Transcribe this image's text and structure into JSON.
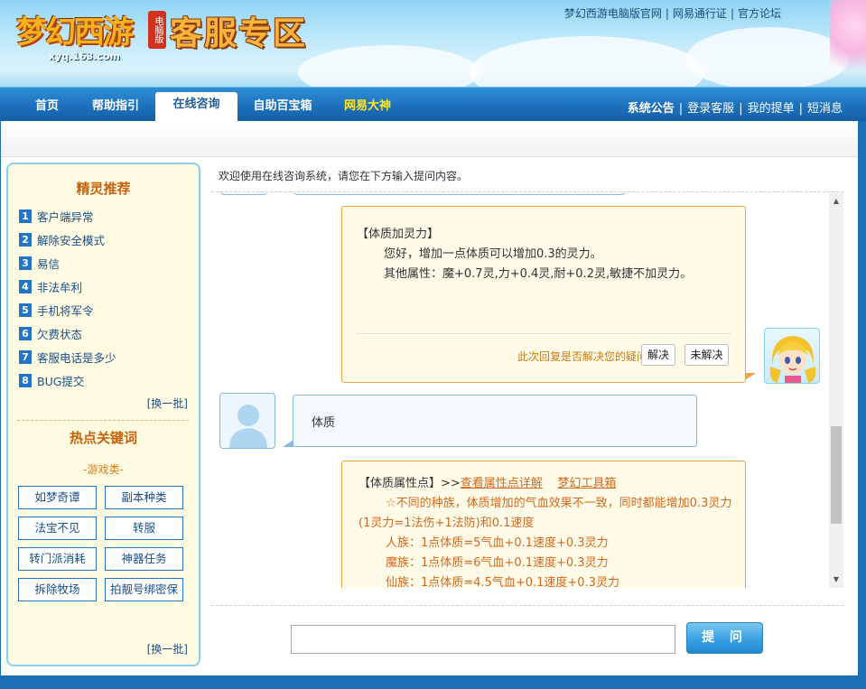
{
  "header": {
    "logo_text": "梦幻西游",
    "logo_badge": "电脑版",
    "logo_url": "xyq.163.com",
    "zone_title": "客服专区",
    "top_links": [
      "梦幻西游电脑版官网",
      "网易通行证",
      "官方论坛"
    ]
  },
  "nav": {
    "tabs": [
      {
        "label": "首页"
      },
      {
        "label": "帮助指引"
      },
      {
        "label": "在线咨询",
        "active": true
      },
      {
        "label": "自助百宝箱"
      },
      {
        "label": "网易大神",
        "highlight": "#ffe629"
      }
    ],
    "right_links": [
      "系统公告",
      "登录客服",
      "我的提单",
      "短消息"
    ]
  },
  "sidebar": {
    "rec_title": "精灵推荐",
    "rec_items": [
      {
        "num": "1",
        "label": "客户端异常"
      },
      {
        "num": "2",
        "label": "解除安全模式"
      },
      {
        "num": "3",
        "label": "易信"
      },
      {
        "num": "4",
        "label": "非法牟利"
      },
      {
        "num": "5",
        "label": "手机将军令"
      },
      {
        "num": "6",
        "label": "欠费状态"
      },
      {
        "num": "7",
        "label": "客服电话是多少"
      },
      {
        "num": "8",
        "label": "BUG提交"
      }
    ],
    "more_label": "[换一批]",
    "hot_title": "热点关键词",
    "category": "-游戏类-",
    "keywords": [
      "如梦奇谭",
      "副本种类",
      "法宝不见",
      "转服",
      "转门派消耗",
      "神器任务",
      "拆除牧场",
      "拍靓号绑密保"
    ],
    "more_label_2": "[换一批]"
  },
  "chat": {
    "welcome": "欢迎使用在线咨询系统，请您在下方输入提问内容。",
    "reply1": {
      "title": "【体质加灵力】",
      "line1": "您好，增加一点体质可以增加0.3的灵力。",
      "line2": "其他属性：魔+0.7灵,力+0.4灵,耐+0.2灵,敏捷不加灵力。",
      "feedback_question": "此次回复是否解决您的疑问:",
      "solved_label": "解决",
      "unsolved_label": "未解决"
    },
    "user_message": "体质",
    "reply2": {
      "title": "【体质属性点】>>",
      "link1": "查看属性点详解",
      "link2": "梦幻工具箱",
      "line1": "☆不同的种族，体质增加的气血效果不一致，同时都能增加0.3灵力(1灵力=1法伤+1法防)和0.1速度",
      "line2": "人族：1点体质=5气血+0.1速度+0.3灵力",
      "line3": "魔族：1点体质=6气血+0.1速度+0.3灵力",
      "line4": "仙族：1点体质=4.5气血+0.1速度+0.3灵力"
    }
  },
  "ask": {
    "input_value": "",
    "button_label": "提 问"
  },
  "colors": {
    "nav_blue": "#1c6fba",
    "reply_border": "#f0a540",
    "reply_text": "#d2691e",
    "user_border": "#8ab7dc"
  }
}
